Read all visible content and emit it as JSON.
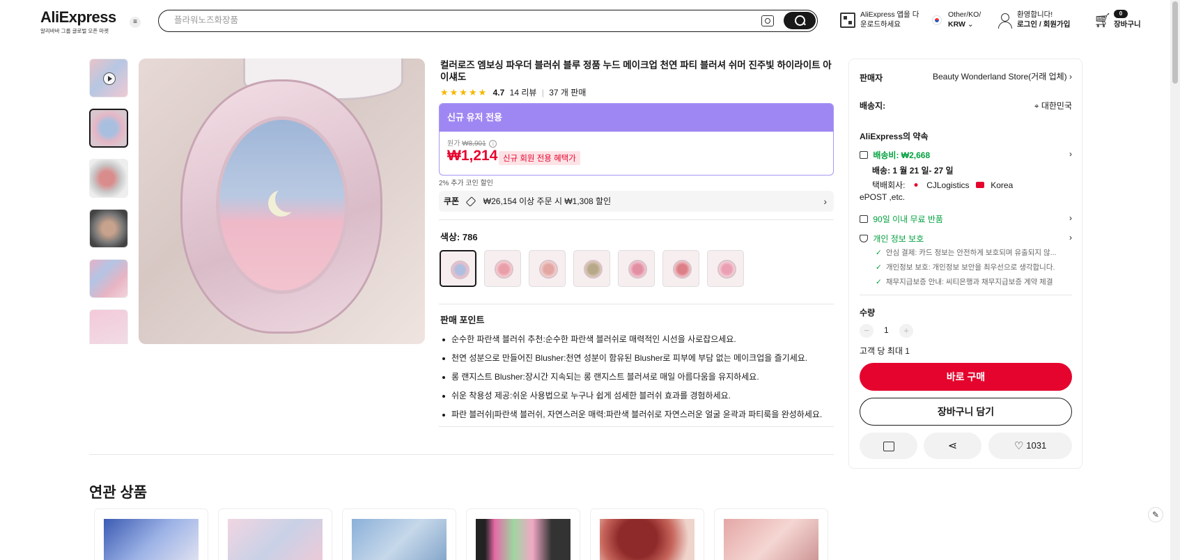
{
  "header": {
    "logo": "AliExpress",
    "logo_sub": "알리바바 그룹 글로벌 오픈 마켓",
    "search_placeholder": "플라워노즈화장품",
    "app_line1": "AliExpress 앱을 다",
    "app_line2": "운로드하세요",
    "locale_line1": "Other/KO/",
    "locale_line2": "KRW",
    "welcome": "환영합니다!",
    "login": "로그인 / 회원가입",
    "cart_count": "0",
    "cart_label": "장바구니"
  },
  "product": {
    "title": "컬러로즈 엠보싱 파우더 블러쉬 블루 정품 누드 메이크업 천연 파티 블러셔 쉬머 진주빛 하이라이트 아이섀도",
    "stars": "★★★★★",
    "rating": "4.7",
    "reviews": "14 리뷰",
    "sep": "|",
    "sold": "37 개 판매",
    "promo_header": "신규 유저 전용",
    "orig_label": "원가",
    "orig_price": "₩8,901",
    "price": "₩1,214",
    "new_badge": "신규 회원 전용 혜택가",
    "coin_note": "2% 추가 코인 할인",
    "coupon_label": "쿠폰",
    "coupon_text": "₩26,154 이상 주문 시 ₩1,308 할인",
    "color_label": "색상: 786",
    "selling_points_title": "판매 포인트",
    "selling_points": [
      "순수한 파란색 블러쉬 추천:순수한 파란색 블러쉬로 매력적인 시선을 사로잡으세요.",
      "천연 성분으로 만들어진 Blusher:천연 성분이 함유된 Blusher로 피부에 부담 없는 메이크업을 즐기세요.",
      "롱 랜지스트 Blusher:장시간 지속되는 롱 랜지스트 블러셔로 매일 아름다움을 유지하세요.",
      "쉬운 착용성 제공:쉬운 사용법으로 누구나 쉽게 섬세한 블러쉬 효과를 경험하세요.",
      "파란 블러쉬|파란색 블러쉬, 자연스러운 매력:파란색 블러쉬로 자연스러운 얼굴 윤곽과 파티룩을 완성하세요."
    ]
  },
  "related_title": "연관 상품",
  "panel": {
    "seller_label": "판매자",
    "seller_name": "Beauty Wonderland Store(거래 업체)",
    "ship_to_label": "배송지:",
    "ship_to": "대한민국",
    "promise_title": "AliExpress의 약속",
    "shipping_fee": "배송비: ₩2,668",
    "delivery": "배송: 1 월 21 일- 27 일",
    "courier_label": "택배회사:",
    "courier1": "CJLogistics",
    "courier2": "Korea",
    "courier3": "ePOST ,etc.",
    "returns": "90일 이내 무료 반품",
    "privacy": "개인 정보 보호",
    "privacy_items": [
      "안심 결제: 카드 정보는 안전하게 보호되며 유출되지 않...",
      "개인정보 보호: 개인정보 보안을 최우선으로 생각합니다.",
      "채무지급보증 안내: 씨티은행과 채무지급보증 계약 체결"
    ],
    "qty_label": "수량",
    "qty_value": "1",
    "qty_minus": "−",
    "qty_plus": "+",
    "per_customer": "고객 당 최대 1",
    "buy_now": "바로 구매",
    "add_cart": "장바구니 담기",
    "wishlist_count": "1031"
  },
  "colors": {
    "price_red": "#e5042d",
    "promo_purple": "#9f87f3",
    "green": "#00a03e"
  }
}
